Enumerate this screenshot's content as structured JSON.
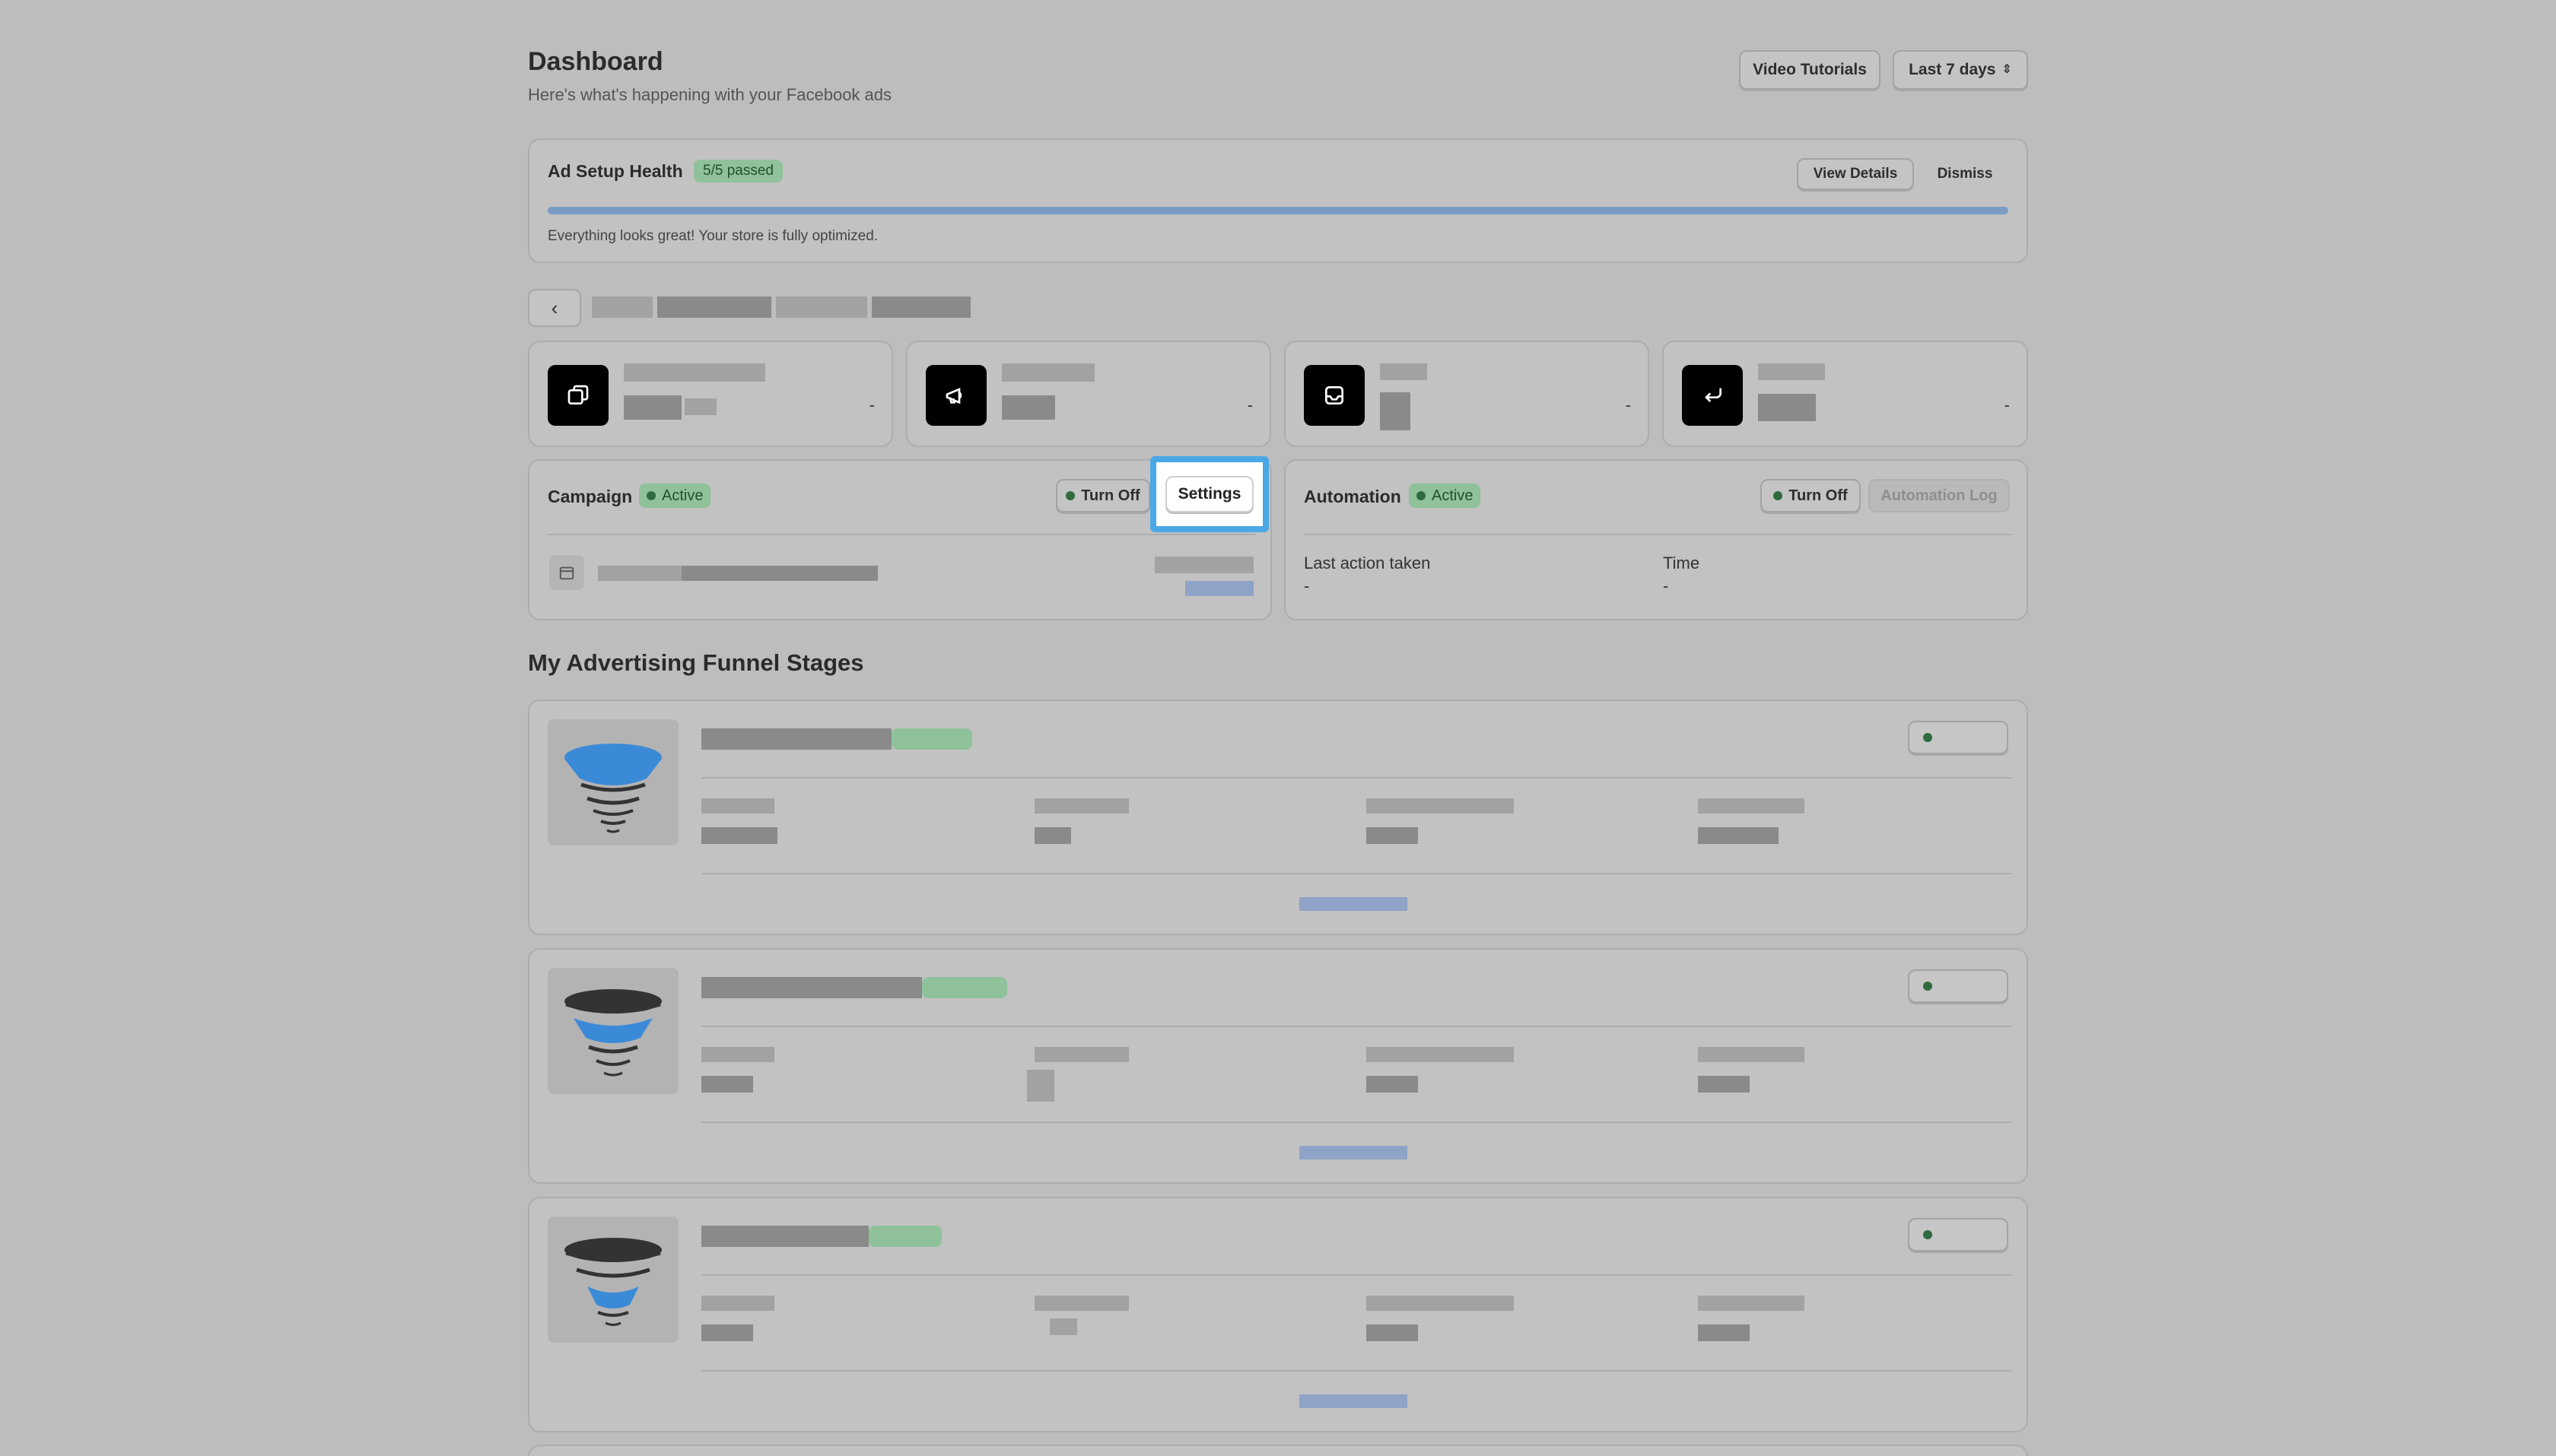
{
  "header": {
    "title": "Dashboard",
    "subtitle": "Here's what's happening with your Facebook ads",
    "tutorials_label": "Video Tutorials",
    "range_label": "Last 7 days"
  },
  "health": {
    "title": "Ad Setup Health",
    "badge": "5/5 passed",
    "view_details": "View Details",
    "dismiss": "Dismiss",
    "message": "Everything looks great! Your store is fully optimized.",
    "progress": 1.0
  },
  "stats": [
    {
      "icon": "copy-icon",
      "value": "-"
    },
    {
      "icon": "megaphone-icon",
      "value": "-"
    },
    {
      "icon": "inbox-icon",
      "value": "-"
    },
    {
      "icon": "return-icon",
      "value": "-"
    }
  ],
  "campaign": {
    "title": "Campaign",
    "status": "Active",
    "turn_off": "Turn Off",
    "settings": "Settings"
  },
  "automation": {
    "title": "Automation",
    "status": "Active",
    "turn_off": "Turn Off",
    "log": "Automation Log",
    "last_action_label": "Last action taken",
    "last_action_value": "-",
    "time_label": "Time",
    "time_value": "-"
  },
  "funnel": {
    "title": "My Advertising Funnel Stages"
  },
  "colors": {
    "accent_focus": "#4aa8e6",
    "active_green": "#8fc29b",
    "funnel_blue": "#3b8ad8"
  }
}
